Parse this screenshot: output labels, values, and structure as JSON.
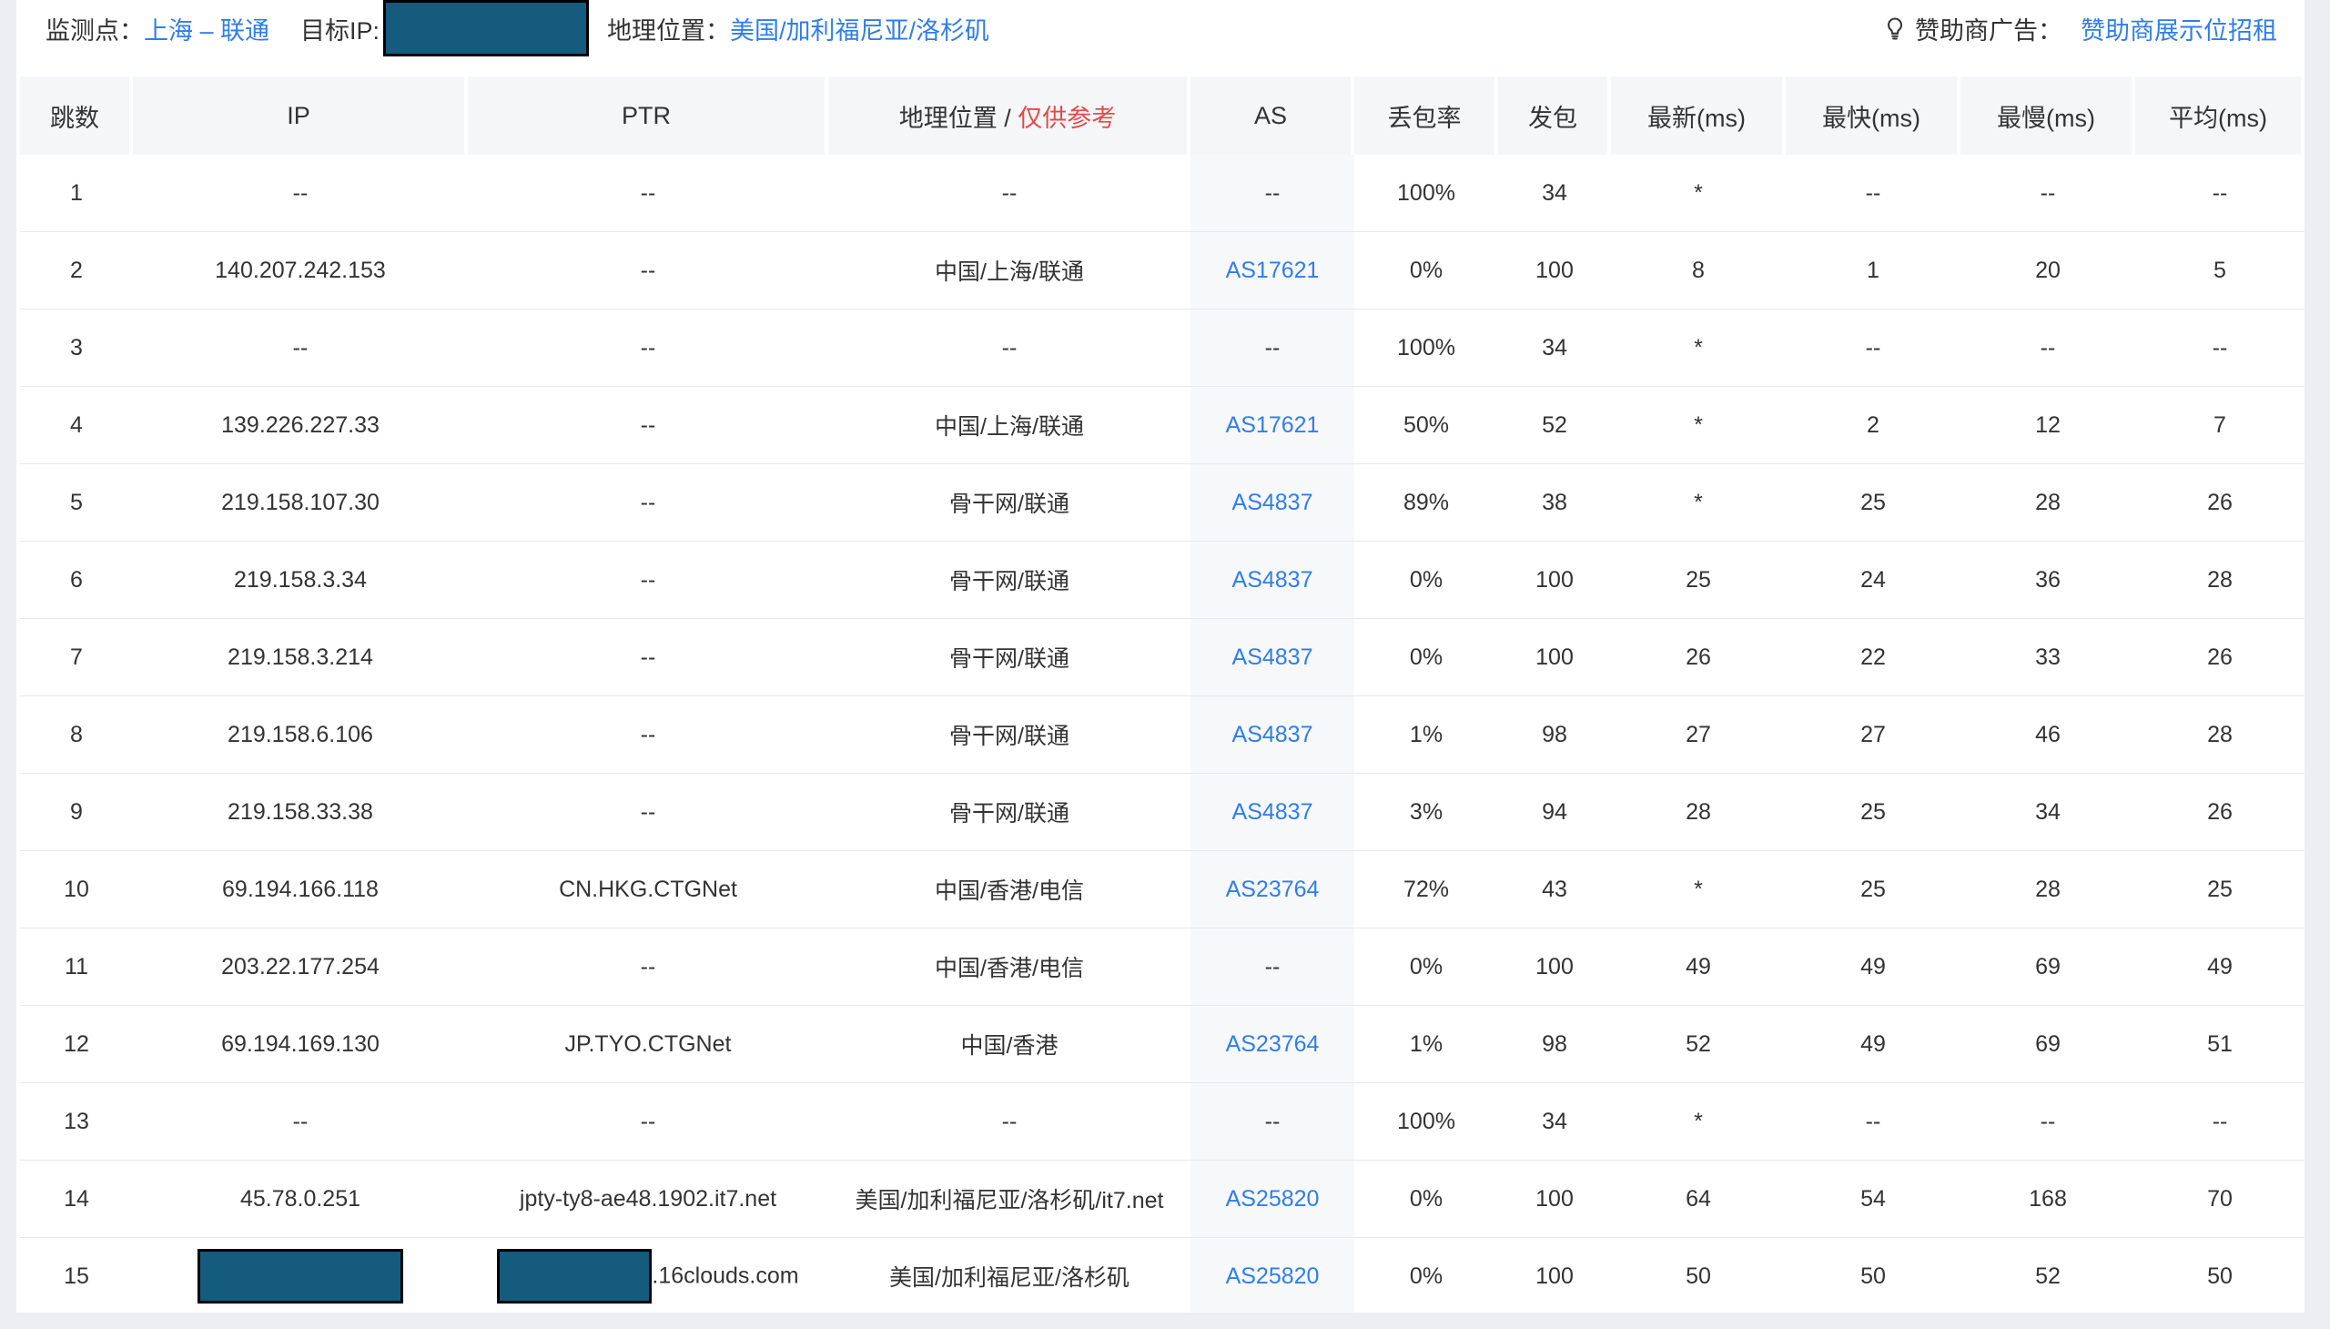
{
  "monitor": {
    "label": "监测点：",
    "value": "上海 – 联通"
  },
  "target": {
    "label": "目标IP:"
  },
  "geo": {
    "label": "地理位置：",
    "value": "美国/加利福尼亚/洛杉矶"
  },
  "sponsor": {
    "icon": "lightbulb-icon",
    "label": "赞助商广告：",
    "value": "赞助商展示位招租"
  },
  "headers": {
    "hop": "跳数",
    "ip": "IP",
    "ptr": "PTR",
    "geo": "地理位置",
    "geo_sep": " / ",
    "geo_note": "仅供参考",
    "as": "AS",
    "loss": "丢包率",
    "sent": "发包",
    "last": "最新(ms)",
    "best": "最快(ms)",
    "worst": "最慢(ms)",
    "avg": "平均(ms)"
  },
  "colors": {
    "link": "#2f7ee8",
    "note_red": "#e44a4a",
    "redaction": "#145b7e"
  },
  "rows": [
    {
      "hop": "1",
      "ip": "--",
      "ptr": "--",
      "geo": "--",
      "as": "--",
      "loss": "100%",
      "sent": "34",
      "last": "*",
      "best": "--",
      "worst": "--",
      "avg": "--"
    },
    {
      "hop": "2",
      "ip": "140.207.242.153",
      "ptr": "--",
      "geo": "中国/上海/联通",
      "as": "AS17621",
      "loss": "0%",
      "sent": "100",
      "last": "8",
      "best": "1",
      "worst": "20",
      "avg": "5"
    },
    {
      "hop": "3",
      "ip": "--",
      "ptr": "--",
      "geo": "--",
      "as": "--",
      "loss": "100%",
      "sent": "34",
      "last": "*",
      "best": "--",
      "worst": "--",
      "avg": "--"
    },
    {
      "hop": "4",
      "ip": "139.226.227.33",
      "ptr": "--",
      "geo": "中国/上海/联通",
      "as": "AS17621",
      "loss": "50%",
      "sent": "52",
      "last": "*",
      "best": "2",
      "worst": "12",
      "avg": "7"
    },
    {
      "hop": "5",
      "ip": "219.158.107.30",
      "ptr": "--",
      "geo": "骨干网/联通",
      "as": "AS4837",
      "loss": "89%",
      "sent": "38",
      "last": "*",
      "best": "25",
      "worst": "28",
      "avg": "26"
    },
    {
      "hop": "6",
      "ip": "219.158.3.34",
      "ptr": "--",
      "geo": "骨干网/联通",
      "as": "AS4837",
      "loss": "0%",
      "sent": "100",
      "last": "25",
      "best": "24",
      "worst": "36",
      "avg": "28"
    },
    {
      "hop": "7",
      "ip": "219.158.3.214",
      "ptr": "--",
      "geo": "骨干网/联通",
      "as": "AS4837",
      "loss": "0%",
      "sent": "100",
      "last": "26",
      "best": "22",
      "worst": "33",
      "avg": "26"
    },
    {
      "hop": "8",
      "ip": "219.158.6.106",
      "ptr": "--",
      "geo": "骨干网/联通",
      "as": "AS4837",
      "loss": "1%",
      "sent": "98",
      "last": "27",
      "best": "27",
      "worst": "46",
      "avg": "28"
    },
    {
      "hop": "9",
      "ip": "219.158.33.38",
      "ptr": "--",
      "geo": "骨干网/联通",
      "as": "AS4837",
      "loss": "3%",
      "sent": "94",
      "last": "28",
      "best": "25",
      "worst": "34",
      "avg": "26"
    },
    {
      "hop": "10",
      "ip": "69.194.166.118",
      "ptr": "CN.HKG.CTGNet",
      "geo": "中国/香港/电信",
      "as": "AS23764",
      "loss": "72%",
      "sent": "43",
      "last": "*",
      "best": "25",
      "worst": "28",
      "avg": "25"
    },
    {
      "hop": "11",
      "ip": "203.22.177.254",
      "ptr": "--",
      "geo": "中国/香港/电信",
      "as": "--",
      "loss": "0%",
      "sent": "100",
      "last": "49",
      "best": "49",
      "worst": "69",
      "avg": "49"
    },
    {
      "hop": "12",
      "ip": "69.194.169.130",
      "ptr": "JP.TYO.CTGNet",
      "geo": "中国/香港",
      "as": "AS23764",
      "loss": "1%",
      "sent": "98",
      "last": "52",
      "best": "49",
      "worst": "69",
      "avg": "51"
    },
    {
      "hop": "13",
      "ip": "--",
      "ptr": "--",
      "geo": "--",
      "as": "--",
      "loss": "100%",
      "sent": "34",
      "last": "*",
      "best": "--",
      "worst": "--",
      "avg": "--"
    },
    {
      "hop": "14",
      "ip": "45.78.0.251",
      "ptr": "jpty-ty8-ae48.1902.it7.net",
      "geo": "美国/加利福尼亚/洛杉矶/it7.net",
      "as": "AS25820",
      "loss": "0%",
      "sent": "100",
      "last": "64",
      "best": "54",
      "worst": "168",
      "avg": "70"
    },
    {
      "hop": "15",
      "ip": "",
      "ip_redacted": true,
      "ptr": ".16clouds.com",
      "ptr_redacted": true,
      "geo": "美国/加利福尼亚/洛杉矶",
      "as": "AS25820",
      "loss": "0%",
      "sent": "100",
      "last": "50",
      "best": "50",
      "worst": "52",
      "avg": "50"
    }
  ]
}
